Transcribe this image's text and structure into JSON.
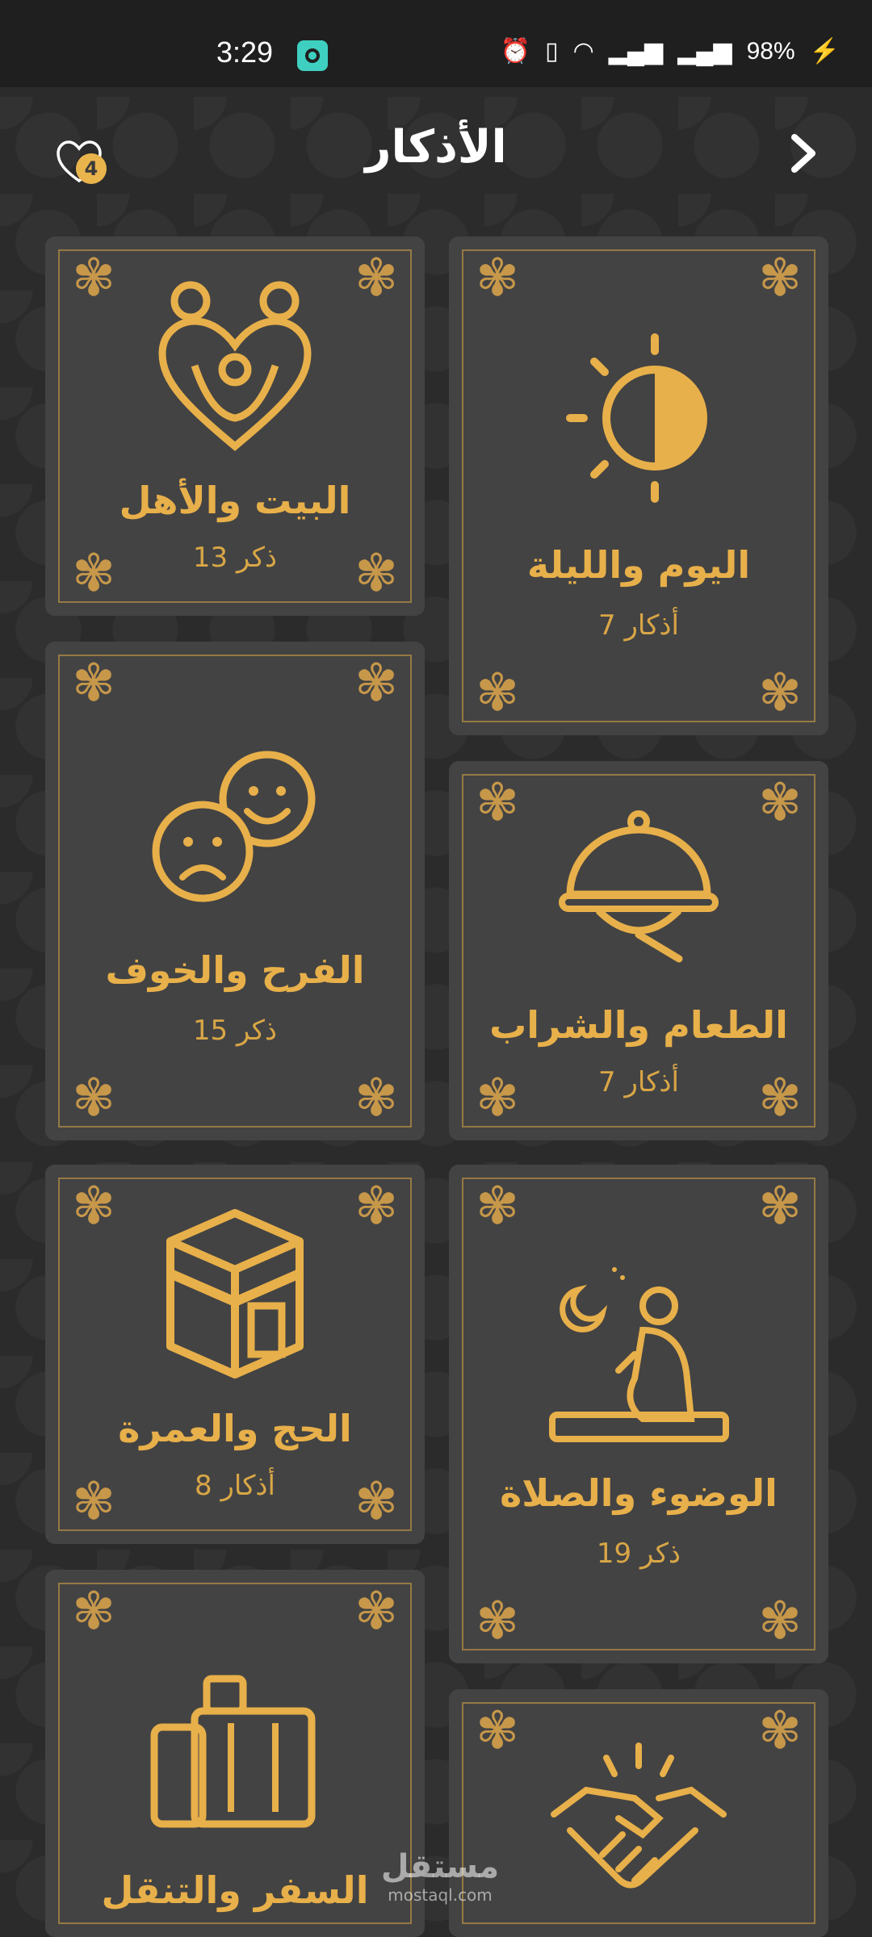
{
  "status_bar": {
    "time": "3:29",
    "battery": "98%"
  },
  "header": {
    "title": "الأذكار",
    "favorites_count": "4"
  },
  "cards": [
    {
      "title": "اليوم والليلة",
      "count": "7 أذكار",
      "icon": "sun-moon-icon"
    },
    {
      "title": "البيت والأهل",
      "count": "13 ذكر",
      "icon": "family-heart-icon"
    },
    {
      "title": "الطعام والشراب",
      "count": "7 أذكار",
      "icon": "food-cloche-icon"
    },
    {
      "title": "الفرح والخوف",
      "count": "15 ذكر",
      "icon": "happy-sad-faces-icon"
    },
    {
      "title": "الوضوء والصلاة",
      "count": "19 ذكر",
      "icon": "praying-person-icon"
    },
    {
      "title": "الحج والعمرة",
      "count": "8 أذكار",
      "icon": "kaaba-icon"
    },
    {
      "title": "السفر والتنقل",
      "count": "",
      "icon": "luggage-icon"
    },
    {
      "title": "",
      "count": "",
      "icon": "handshake-icon"
    }
  ],
  "watermark": {
    "arabic": "مستقل",
    "latin": "mostaql.com"
  },
  "colors": {
    "gold": "#e8b04a",
    "card_bg": "#434343",
    "page_bg": "#2b2b2b"
  }
}
